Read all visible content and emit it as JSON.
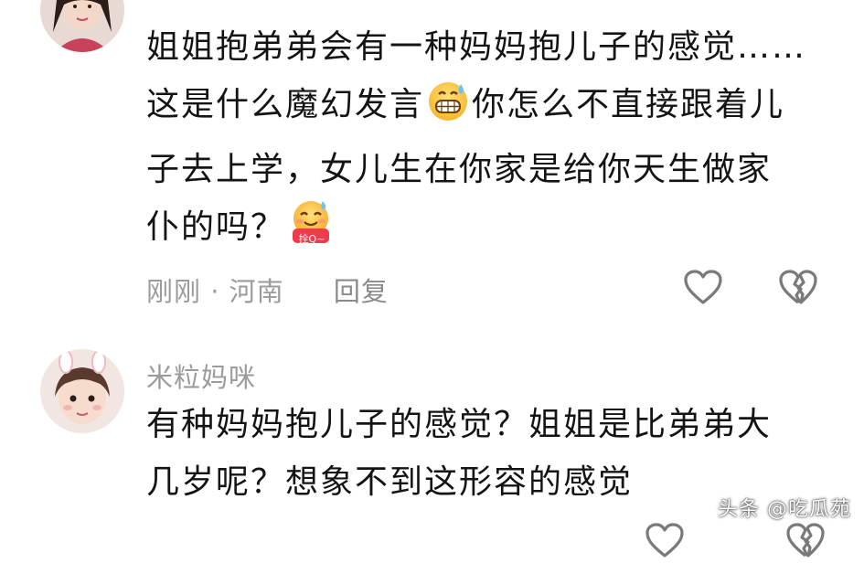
{
  "comments": [
    {
      "username": "",
      "lines": [
        "姐姐抱弟弟会有一种妈妈抱儿子的感觉……",
        "这是什么魔幻发言",
        "你怎么不直接跟着儿",
        "子去上学，女儿生在你家是给你天生做家",
        "仆的吗？"
      ],
      "emoji_1": "grinning-sweat-emoji",
      "emoji_2": "hug-emoji",
      "emoji_2_caption": "拴Q~",
      "time": "刚刚",
      "separator": "·",
      "location": "河南",
      "reply_label": "回复"
    },
    {
      "username": "米粒妈咪",
      "lines": [
        "有种妈妈抱儿子的感觉？姐姐是比弟弟大",
        "几岁呢？想象不到这形容的感觉"
      ]
    }
  ],
  "icons": {
    "like": "heart-outline-icon",
    "dislike": "broken-heart-icon"
  },
  "watermark": "头条 @吃瓜苑",
  "colors": {
    "text": "#141414",
    "meta": "#9b9b9b",
    "icon": "#7a7a7a"
  }
}
